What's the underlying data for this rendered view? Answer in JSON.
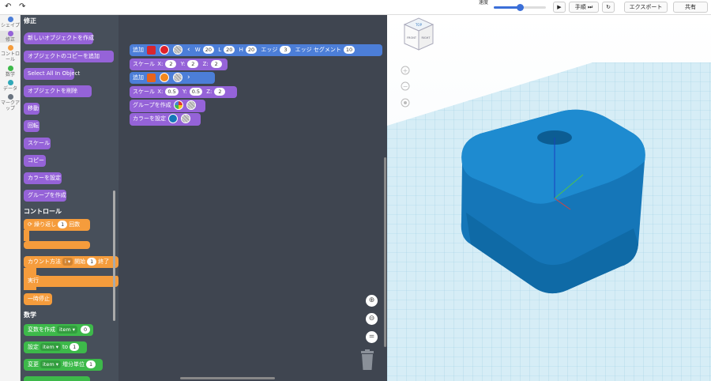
{
  "toolbar": {
    "undo_icon": "undo-icon",
    "redo_icon": "redo-icon",
    "speed_label": "速度",
    "speed_value": 0.5,
    "play_icon": "play-icon",
    "step_label": "手順",
    "reset_icon": "reset-icon",
    "export_label": "エクスポート",
    "share_label": "共有"
  },
  "categories": [
    {
      "label": "シェイプ",
      "color": "#4c7ed8"
    },
    {
      "label": "修正",
      "color": "#9563d8"
    },
    {
      "label": "コントロール",
      "color": "#f59c3c"
    },
    {
      "label": "数学",
      "color": "#3db94a"
    },
    {
      "label": "データ",
      "color": "#2fa8b8"
    },
    {
      "label": "マークアップ",
      "color": "#6a7480"
    }
  ],
  "flyout": {
    "modify_header": "修正",
    "modify_blocks": [
      "新しいオブジェクトを作成",
      "オブジェクトのコピーを追加",
      "Select All In Object",
      "オブジェクトを削除",
      "移動",
      "回転",
      "スケール",
      "コピー",
      "カラーを設定",
      "グループを作成"
    ],
    "control_header": "コントロール",
    "repeat_label": "繰り返し",
    "repeat_count": "1",
    "repeat_unit": "回数",
    "count_label": "カウント方法",
    "count_var": "i",
    "count_start_label": "開始",
    "count_start": "1",
    "count_end_label": "終了",
    "run_label": "実行",
    "pause_label": "一時停止",
    "math_header": "数学",
    "create_var_label": "変数を作成",
    "create_var_name": "item",
    "create_var_value": "0",
    "set_label": "設定",
    "set_var": "item",
    "set_to": "to",
    "set_value": "1",
    "change_label": "変更",
    "change_var": "item",
    "change_by": "増分単位",
    "change_value": "1"
  },
  "workspace": {
    "row1": {
      "add": "追加",
      "w_label": "W",
      "w": "20",
      "l_label": "L",
      "l": "20",
      "h_label": "H",
      "h": "20",
      "edge_label": "エッジ",
      "edge": "3",
      "seg_label": "エッジ セグメント",
      "seg": "10"
    },
    "row2": {
      "scale": "スケール",
      "x_label": "X:",
      "x": "2",
      "y_label": "Y:",
      "y": "2",
      "z_label": "Z:",
      "z": "2"
    },
    "row3": {
      "add": "追加"
    },
    "row4": {
      "scale": "スケール",
      "x_label": "X:",
      "x": "0.5",
      "y_label": "Y:",
      "y": "0.5",
      "z_label": "Z:",
      "z": "2"
    },
    "row5": {
      "group": "グループを作成"
    },
    "row6": {
      "color": "カラーを設定"
    }
  },
  "viewport": {
    "cube_top": "TOP",
    "cube_front": "FRONT",
    "cube_right": "RIGHT",
    "object_color": "#1576b8",
    "grid_color": "#bfe3f0"
  }
}
